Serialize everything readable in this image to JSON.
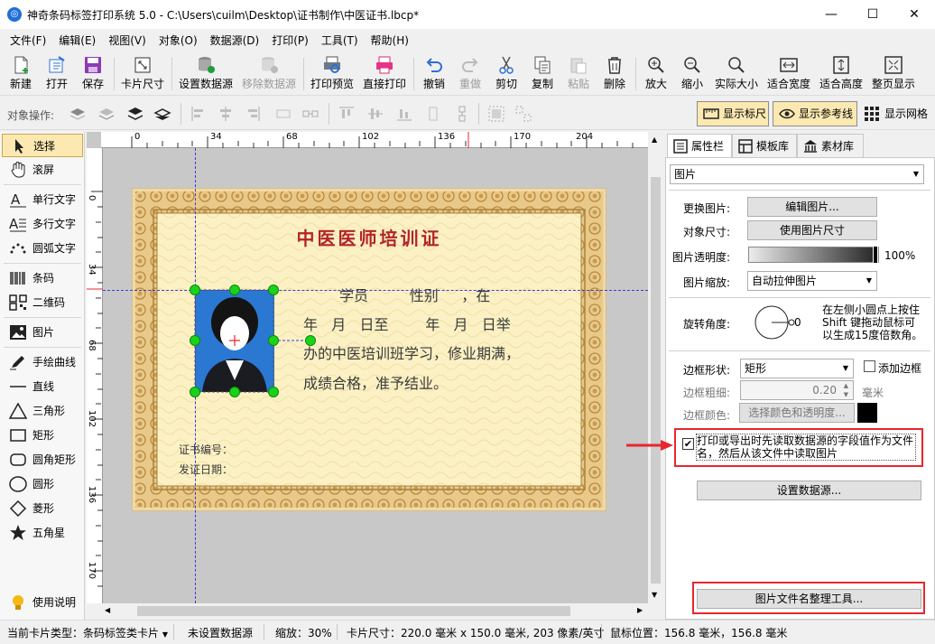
{
  "window": {
    "title": "神奇条码标签打印系统 5.0 - C:\\Users\\cuilm\\Desktop\\证书制作\\中医证书.lbcp*",
    "app_icon_glyph": "◎"
  },
  "menu": [
    "文件(F)",
    "编辑(E)",
    "视图(V)",
    "对象(O)",
    "数据源(D)",
    "打印(P)",
    "工具(T)",
    "帮助(H)"
  ],
  "toolbar": {
    "new": "新建",
    "open": "打开",
    "save": "保存",
    "card_size": "卡片尺寸",
    "set_datasource": "设置数据源",
    "remove_datasource": "移除数据源",
    "print_preview": "打印预览",
    "direct_print": "直接打印",
    "undo": "撤销",
    "redo": "重做",
    "cut": "剪切",
    "copy": "复制",
    "paste": "粘贴",
    "delete": "删除",
    "zoom_in": "放大",
    "zoom_out": "缩小",
    "actual_size": "实际大小",
    "fit_width": "适合宽度",
    "fit_height": "适合高度",
    "fit_page": "整页显示"
  },
  "objbar": {
    "label": "对象操作:",
    "show_ruler": "显示标尺",
    "show_guides": "显示参考线",
    "show_grid": "显示网格"
  },
  "tools": {
    "select": "选择",
    "scroll": "滚屏",
    "single_text": "单行文字",
    "multi_text": "多行文字",
    "arc_text": "圆弧文字",
    "barcode": "条码",
    "qrcode": "二维码",
    "image": "图片",
    "freehand": "手绘曲线",
    "line": "直线",
    "triangle": "三角形",
    "rect": "矩形",
    "round_rect": "圆角矩形",
    "circle": "圆形",
    "diamond": "菱形",
    "star": "五角星",
    "help": "使用说明"
  },
  "ruler": {
    "h_ticks": [
      "0",
      "34",
      "68",
      "102",
      "136",
      "170",
      "204"
    ],
    "v_ticks": [
      "0",
      "34",
      "68",
      "102",
      "136",
      "170"
    ]
  },
  "certificate": {
    "title": "中医医师培训证",
    "line1": "学员         性别     ，在",
    "line2": "年   月   日至        年   月   日举",
    "line3": "办的中医培训班学习，修业期满，",
    "line4": "成绩合格，准予结业。",
    "cert_no": "证书编号：",
    "issue_date": "发证日期："
  },
  "panel": {
    "tabs": [
      "属性栏",
      "模板库",
      "素材库"
    ],
    "object_type": "图片",
    "replace_image_label": "更换图片:",
    "edit_image_btn": "编辑图片...",
    "object_size_label": "对象尺寸:",
    "use_image_size_btn": "使用图片尺寸",
    "opacity_label": "图片透明度:",
    "opacity_value": "100%",
    "scale_label": "图片缩放:",
    "scale_value": "自动拉伸图片",
    "rotate_label": "旋转角度:",
    "rotate_value": "0",
    "rotate_hint": "在左侧小圆点上按住Shift 键拖动鼠标可以生成15度倍数角。",
    "border_shape_label": "边框形状:",
    "border_shape_value": "矩形",
    "add_border": "添加边框",
    "border_width_label": "边框粗细:",
    "border_width_value": "0.20",
    "border_width_unit": "毫米",
    "border_color_label": "边框颜色:",
    "border_color_btn": "选择颜色和透明度...",
    "read_from_data_text": "打印或导出时先读取数据源的字段值作为文件名，然后从该文件中读取图片",
    "set_datasource_btn": "设置数据源...",
    "rename_tool_btn": "图片文件名整理工具..."
  },
  "status": {
    "card_type": "当前卡片类型：条码标签类卡片",
    "datasource": "未设置数据源",
    "zoom": "缩放：30%",
    "card_size": "卡片尺寸：220.0 毫米 x 150.0 毫米, 203 像素/英寸",
    "mouse_pos": "鼠标位置：156.8 毫米，156.8 毫米"
  },
  "colors": {
    "highlight_red": "#e8262d",
    "cert_title": "#b3242a",
    "selection_green": "#19d219",
    "toggle_active": "#fce9b2"
  }
}
